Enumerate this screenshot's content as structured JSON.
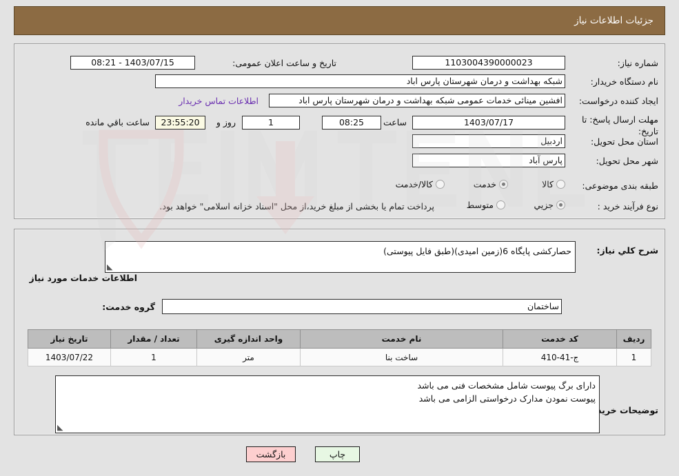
{
  "header": {
    "title": "جزئیات اطلاعات نیاز"
  },
  "top_panel": {
    "need_number": {
      "label": "شماره نیاز:",
      "value": "1103004390000023"
    },
    "announce_datetime": {
      "label": "تاریخ و ساعت اعلان عمومی:",
      "value": "1403/07/15 - 08:21"
    },
    "buyer_org": {
      "label": "نام دستگاه خریدار:",
      "value": "شبکه بهداشت و درمان شهرستان پارس اباد"
    },
    "requester": {
      "label": "ایجاد کننده درخواست:",
      "value": "افشین مینائی خدمات عمومی شبکه بهداشت و درمان شهرستان پارس اباد"
    },
    "buyer_contact_link": "اطلاعات تماس خریدار",
    "deadline": {
      "label": "مهلت ارسال پاسخ: تا تاریخ:",
      "date": "1403/07/17",
      "time_label": "ساعت",
      "time": "08:25",
      "days": "1",
      "days_suffix": "روز و",
      "countdown": "23:55:20",
      "countdown_suffix": "ساعت باقي مانده"
    },
    "province": {
      "label": "استان محل تحویل:",
      "value": "اردبیل"
    },
    "city": {
      "label": "شهر محل تحویل:",
      "value": "پارس آباد"
    },
    "category": {
      "label": "طبقه بندی موضوعی:",
      "options": [
        {
          "label": "کالا",
          "selected": false
        },
        {
          "label": "خدمت",
          "selected": true
        },
        {
          "label": "کالا/خدمت",
          "selected": false
        }
      ]
    },
    "purchase_type": {
      "label": "نوع فرآیند خرید :",
      "options": [
        {
          "label": "جزیي",
          "selected": true
        },
        {
          "label": "متوسط",
          "selected": false
        }
      ],
      "note": "پرداخت تمام یا بخشی از مبلغ خرید،از محل \"اسناد خزانه اسلامی\" خواهد بود."
    }
  },
  "bottom_panel": {
    "general_description": {
      "label": "شرح کلي نیاز:",
      "value": "حصارکشی پایگاه 6(زمین امیدی)(طبق فایل پیوستی)"
    },
    "services_section_title": "اطلاعات خدمات مورد نیاز",
    "service_group": {
      "label": "گروه خدمت:",
      "value": "ساختمان"
    },
    "table": {
      "columns": [
        "ردیف",
        "کد خدمت",
        "نام خدمت",
        "واحد اندازه گیری",
        "تعداد / مقدار",
        "تاریخ نیاز"
      ],
      "rows": [
        [
          "1",
          "ج-41-410",
          "ساخت بنا",
          "متر",
          "1",
          "1403/07/22"
        ]
      ]
    },
    "buyer_notes": {
      "label": "توضیحات خریدار:",
      "lines": [
        "دارای برگ پیوست شامل مشخصات فنی می باشد",
        "پیوست نمودن مدارک درخواستی الزامی می باشد"
      ]
    }
  },
  "footer": {
    "print_label": "چاپ",
    "back_label": "بازگشت"
  },
  "watermark": {
    "text": "AriaTender.net"
  },
  "colors": {
    "header_bg": "#8c6b43",
    "link": "#6a2fb0",
    "countdown_bg": "#fbfae4",
    "print_bg": "#e7f7e3",
    "back_bg": "#fdcfcf"
  }
}
